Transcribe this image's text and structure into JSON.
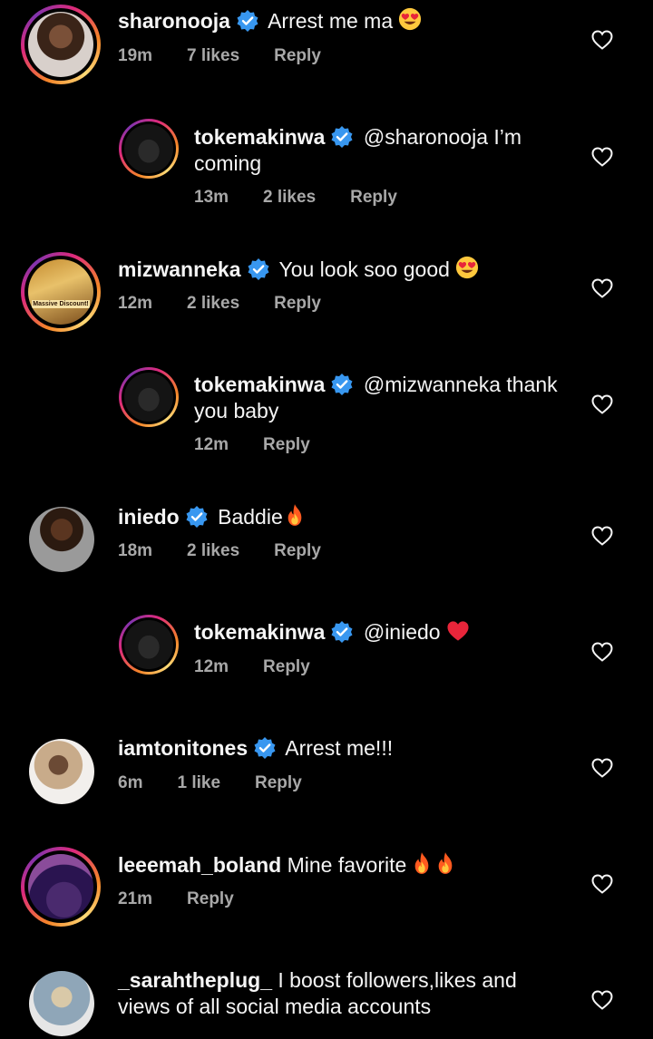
{
  "comments": [
    {
      "username": "sharonooja",
      "text": "Arrest me ma",
      "emoji": "heart-eyes",
      "time": "19m",
      "likes": "7 likes",
      "reply": "Reply"
    },
    {
      "username": "tokemakinwa",
      "text": "@sharonooja I’m coming",
      "time": "13m",
      "likes": "2 likes",
      "reply": "Reply"
    },
    {
      "username": "mizwanneka",
      "text": "You look soo good",
      "emoji": "heart-eyes",
      "time": "12m",
      "likes": "2 likes",
      "reply": "Reply",
      "avatar_text_1": "Massive Discount!"
    },
    {
      "username": "tokemakinwa",
      "text": "@mizwanneka thank you baby",
      "time": "12m",
      "reply": "Reply"
    },
    {
      "username": "iniedo",
      "text": "Baddie",
      "emoji": "fire",
      "time": "18m",
      "likes": "2 likes",
      "reply": "Reply"
    },
    {
      "username": "tokemakinwa",
      "text": "@iniedo",
      "emoji": "red-heart",
      "time": "12m",
      "reply": "Reply"
    },
    {
      "username": "iamtonitones",
      "text": "Arrest me!!!",
      "time": "6m",
      "likes": "1 like",
      "reply": "Reply"
    },
    {
      "username": "leeemah_boland",
      "text": "Mine favorite",
      "emoji": "fire-fire",
      "time": "21m",
      "reply": "Reply"
    },
    {
      "username": "_sarahtheplug_",
      "text": "I boost followers,likes and views of all social media accounts"
    }
  ],
  "colors": {
    "background": "#000000",
    "text": "#f5f5f5",
    "meta": "#a8a8a8",
    "verified": "#3897f0"
  },
  "icons": {
    "verified": "verified-badge-icon",
    "like": "heart-outline-icon"
  }
}
